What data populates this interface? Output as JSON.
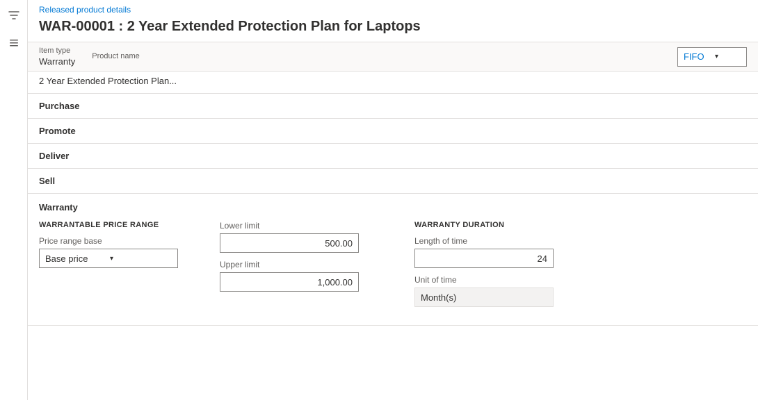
{
  "breadcrumb": {
    "label": "Released product details"
  },
  "page": {
    "title": "WAR-00001 : 2 Year Extended Protection Plan for Laptops"
  },
  "top_row": {
    "item_type_label": "Item type",
    "item_type_value": "Warranty",
    "product_name_label": "Product name",
    "product_name_value": "2 Year Extended Protection Plan...",
    "fifo_label": "FIFO",
    "fifo_chevron": "▾"
  },
  "sections": [
    {
      "id": "purchase",
      "label": "Purchase"
    },
    {
      "id": "promote",
      "label": "Promote"
    },
    {
      "id": "deliver",
      "label": "Deliver"
    },
    {
      "id": "sell",
      "label": "Sell"
    }
  ],
  "warranty_section": {
    "title": "Warranty",
    "warrantable_price_range": {
      "group_title": "WARRANTABLE PRICE RANGE",
      "price_range_base_label": "Price range base",
      "price_range_base_value": "Base price",
      "price_range_chevron": "▾",
      "lower_limit_label": "Lower limit",
      "lower_limit_value": "500.00",
      "upper_limit_label": "Upper limit",
      "upper_limit_value": "1,000.00"
    },
    "warranty_duration": {
      "group_title": "WARRANTY DURATION",
      "length_of_time_label": "Length of time",
      "length_of_time_value": "24",
      "unit_of_time_label": "Unit of time",
      "unit_of_time_value": "Month(s)"
    }
  },
  "icons": {
    "filter": "⊟",
    "hamburger": "≡"
  }
}
